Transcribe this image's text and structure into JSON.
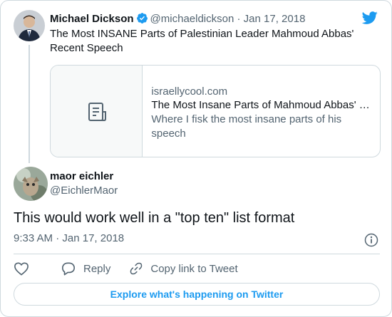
{
  "parent_tweet": {
    "author_name": "Michael Dickson",
    "handle": "@michaeldickson",
    "separator": "·",
    "date": "Jan 17, 2018",
    "text": "The Most INSANE Parts of Palestinian Leader Mahmoud Abbas' Recent Speech",
    "link_card": {
      "domain": "israellycool.com",
      "title": "The Most Insane Parts of Mahmoud Abbas' Recent Speech",
      "description": "Where I fisk the most insane parts of his speech"
    }
  },
  "reply_tweet": {
    "author_name": "maor eichler",
    "handle": "@EichlerMaor",
    "text": "This would work well in a \"top ten\" list format",
    "time": "9:33 AM",
    "separator": "·",
    "date": "Jan 17, 2018"
  },
  "actions": {
    "reply_label": "Reply",
    "copy_link_label": "Copy link to Tweet"
  },
  "explore_button_label": "Explore what's happening on Twitter",
  "colors": {
    "brand": "#1d9bf0",
    "text_primary": "#0f1419",
    "text_secondary": "#536471",
    "border": "#cfd9de"
  },
  "icons": [
    "twitter-bird-icon",
    "verified-badge-icon",
    "article-icon",
    "info-icon",
    "heart-icon",
    "reply-icon",
    "link-icon"
  ]
}
